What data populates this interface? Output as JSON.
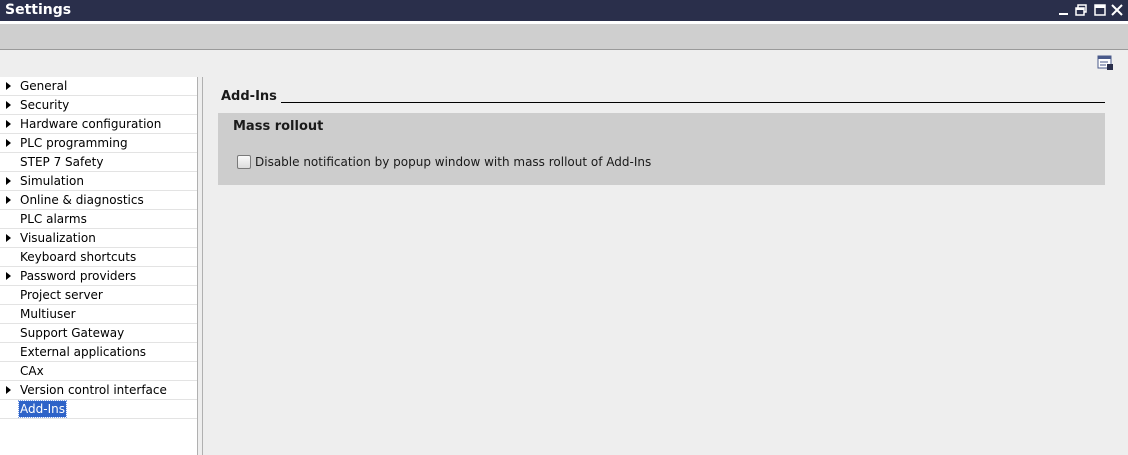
{
  "window": {
    "title": "Settings",
    "controls": [
      "minimize-icon",
      "restore-icon",
      "maximize-icon",
      "close-icon"
    ]
  },
  "sidebar": {
    "items": [
      {
        "label": "General",
        "expandable": true
      },
      {
        "label": "Security",
        "expandable": true
      },
      {
        "label": "Hardware configuration",
        "expandable": true
      },
      {
        "label": "PLC programming",
        "expandable": true
      },
      {
        "label": "STEP 7 Safety",
        "expandable": false
      },
      {
        "label": "Simulation",
        "expandable": true
      },
      {
        "label": "Online & diagnostics",
        "expandable": true
      },
      {
        "label": "PLC alarms",
        "expandable": false
      },
      {
        "label": "Visualization",
        "expandable": true
      },
      {
        "label": "Keyboard shortcuts",
        "expandable": false
      },
      {
        "label": "Password providers",
        "expandable": true
      },
      {
        "label": "Project server",
        "expandable": false
      },
      {
        "label": "Multiuser",
        "expandable": false
      },
      {
        "label": "Support Gateway",
        "expandable": false
      },
      {
        "label": "External applications",
        "expandable": false
      },
      {
        "label": "CAx",
        "expandable": false
      },
      {
        "label": "Version control interface",
        "expandable": true
      },
      {
        "label": "Add-Ins",
        "expandable": false,
        "selected": true
      }
    ]
  },
  "main": {
    "section_title": "Add-Ins",
    "group": {
      "title": "Mass rollout",
      "checkbox": {
        "label": "Disable notification by popup window with mass rollout of Add-Ins",
        "checked": false
      }
    }
  },
  "colors": {
    "titlebar": "#2a2f4b",
    "selection": "#2e63c8",
    "group_bg": "#cdcdcd"
  }
}
